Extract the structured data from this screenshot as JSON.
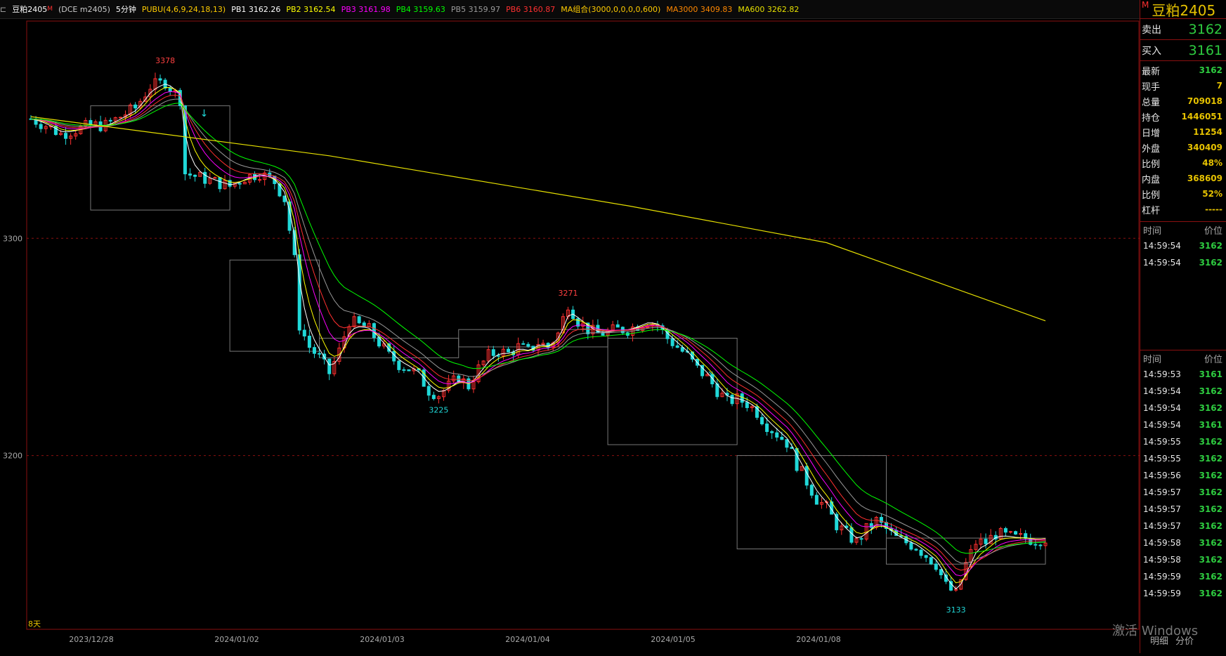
{
  "topbar": {
    "menu_icon": "menu-icon",
    "symbol": "豆粕2405",
    "flag": "M",
    "code": "(DCE m2405)",
    "period": "5分钟",
    "indicator": "PUBU(4,6,9,24,18,13)",
    "pb1": "PB1 3162.26",
    "pb2": "PB2 3162.54",
    "pb3": "PB3 3161.98",
    "pb4": "PB4 3159.63",
    "pb5": "PB5 3159.97",
    "pb6": "PB6 3160.87",
    "ma_combo": "MA组合(3000,0,0,0,0,600)",
    "ma3000": "MA3000 3409.83",
    "ma600": "MA600 3262.82"
  },
  "colors": {
    "pb1": "#ffffff",
    "pb2": "#ffff00",
    "pb3": "#ff00ff",
    "pb4": "#00ff00",
    "pb5": "#9a9a9a",
    "pb6": "#ff3030",
    "ma_combo": "#ffcc00",
    "ma3000": "#ff8800",
    "ma600": "#e6e000",
    "up": "#ff3030",
    "down": "#20d8d8"
  },
  "chart_data": {
    "type": "candlestick",
    "y_labels": [
      "3300",
      "3200"
    ],
    "x_labels": [
      "2023/12/28",
      "2024/01/02",
      "2024/01/03",
      "2024/01/04",
      "2024/01/05",
      "2024/01/08"
    ],
    "range_label": "8天",
    "annotations": {
      "high_label": "3378",
      "low1_label": "3225",
      "high2_label": "3271",
      "low2_label": "3133"
    },
    "ylim": [
      3120,
      3400
    ],
    "price_path": [
      [
        0,
        3355
      ],
      [
        3,
        3352
      ],
      [
        6,
        3348
      ],
      [
        9,
        3350
      ],
      [
        12,
        3352
      ],
      [
        15,
        3352
      ],
      [
        18,
        3356
      ],
      [
        21,
        3360
      ],
      [
        24,
        3370
      ],
      [
        27,
        3372
      ],
      [
        30,
        3364
      ],
      [
        31,
        3330
      ],
      [
        34,
        3328
      ],
      [
        37,
        3326
      ],
      [
        40,
        3324
      ],
      [
        43,
        3328
      ],
      [
        46,
        3330
      ],
      [
        49,
        3326
      ],
      [
        51,
        3318
      ],
      [
        53,
        3290
      ],
      [
        54,
        3260
      ],
      [
        56,
        3250
      ],
      [
        58,
        3245
      ],
      [
        60,
        3238
      ],
      [
        62,
        3248
      ],
      [
        64,
        3262
      ],
      [
        66,
        3260
      ],
      [
        68,
        3258
      ],
      [
        70,
        3252
      ],
      [
        72,
        3246
      ],
      [
        74,
        3242
      ],
      [
        76,
        3240
      ],
      [
        78,
        3237
      ],
      [
        80,
        3230
      ],
      [
        82,
        3228
      ],
      [
        84,
        3232
      ],
      [
        86,
        3236
      ],
      [
        88,
        3232
      ],
      [
        90,
        3240
      ],
      [
        92,
        3246
      ],
      [
        94,
        3248
      ],
      [
        96,
        3247
      ],
      [
        98,
        3250
      ],
      [
        100,
        3248
      ],
      [
        102,
        3252
      ],
      [
        104,
        3250
      ],
      [
        106,
        3256
      ],
      [
        108,
        3270
      ],
      [
        110,
        3262
      ],
      [
        112,
        3258
      ],
      [
        114,
        3256
      ],
      [
        116,
        3257
      ],
      [
        118,
        3258
      ],
      [
        120,
        3258
      ],
      [
        122,
        3260
      ],
      [
        124,
        3262
      ],
      [
        126,
        3260
      ],
      [
        128,
        3254
      ],
      [
        130,
        3250
      ],
      [
        132,
        3246
      ],
      [
        134,
        3240
      ],
      [
        136,
        3236
      ],
      [
        138,
        3230
      ],
      [
        140,
        3225
      ],
      [
        142,
        3226
      ],
      [
        144,
        3224
      ],
      [
        146,
        3220
      ],
      [
        148,
        3214
      ],
      [
        150,
        3210
      ],
      [
        152,
        3206
      ],
      [
        154,
        3196
      ],
      [
        156,
        3188
      ],
      [
        158,
        3180
      ],
      [
        160,
        3176
      ],
      [
        162,
        3168
      ],
      [
        164,
        3164
      ],
      [
        166,
        3160
      ],
      [
        168,
        3166
      ],
      [
        170,
        3170
      ],
      [
        172,
        3166
      ],
      [
        174,
        3162
      ],
      [
        176,
        3160
      ],
      [
        178,
        3158
      ],
      [
        180,
        3154
      ],
      [
        182,
        3150
      ],
      [
        184,
        3140
      ],
      [
        186,
        3136
      ],
      [
        188,
        3150
      ],
      [
        190,
        3160
      ],
      [
        192,
        3160
      ],
      [
        194,
        3164
      ],
      [
        196,
        3163
      ],
      [
        198,
        3162
      ],
      [
        200,
        3162
      ],
      [
        202,
        3161
      ],
      [
        204,
        3162
      ]
    ],
    "ma600_path": [
      [
        0,
        3356
      ],
      [
        60,
        3338
      ],
      [
        120,
        3315
      ],
      [
        160,
        3298
      ],
      [
        204,
        3262
      ]
    ],
    "ma3000_label": "MA3000 3409.83",
    "boxes": [
      [
        12,
        3361,
        40,
        3313
      ],
      [
        40,
        3290,
        58,
        3248
      ],
      [
        58,
        3254,
        86,
        3245
      ],
      [
        86,
        3258,
        116,
        3250
      ],
      [
        116,
        3254,
        142,
        3205
      ],
      [
        142,
        3200,
        172,
        3157
      ],
      [
        172,
        3162,
        204,
        3150
      ]
    ]
  },
  "panel": {
    "flag": "M",
    "title": "豆粕2405",
    "sell_label": "卖出",
    "sell_val": "3162",
    "buy_label": "买入",
    "buy_val": "3161",
    "stats": [
      {
        "label": "最新",
        "value": "3162",
        "color": "#2ecc40"
      },
      {
        "label": "现手",
        "value": "7",
        "color": "#e6c200"
      },
      {
        "label": "总量",
        "value": "709018",
        "color": "#e6c200"
      },
      {
        "label": "持仓",
        "value": "1446051",
        "color": "#e6c200"
      },
      {
        "label": "日增",
        "value": "11254",
        "color": "#e6c200"
      },
      {
        "label": "外盘",
        "value": "340409",
        "color": "#e6c200"
      },
      {
        "label": "比例",
        "value": "48%",
        "color": "#e6c200"
      },
      {
        "label": "内盘",
        "value": "368609",
        "color": "#e6c200"
      },
      {
        "label": "比例",
        "value": "52%",
        "color": "#e6c200"
      },
      {
        "label": "杠杆",
        "value": "-----",
        "color": "#e6c200"
      }
    ],
    "tick_head": {
      "time": "时间",
      "price": "价位"
    },
    "ticks1": [
      {
        "time": "14:59:54",
        "price": "3162"
      },
      {
        "time": "14:59:54",
        "price": "3162"
      }
    ],
    "ticks2": [
      {
        "time": "14:59:53",
        "price": "3161"
      },
      {
        "time": "14:59:54",
        "price": "3162"
      },
      {
        "time": "14:59:54",
        "price": "3162"
      },
      {
        "time": "14:59:54",
        "price": "3161"
      },
      {
        "time": "14:59:55",
        "price": "3162"
      },
      {
        "time": "14:59:55",
        "price": "3162"
      },
      {
        "time": "14:59:56",
        "price": "3162"
      },
      {
        "time": "14:59:57",
        "price": "3162"
      },
      {
        "time": "14:59:57",
        "price": "3162"
      },
      {
        "time": "14:59:57",
        "price": "3162"
      },
      {
        "time": "14:59:58",
        "price": "3162"
      },
      {
        "time": "14:59:58",
        "price": "3162"
      },
      {
        "time": "14:59:59",
        "price": "3162"
      },
      {
        "time": "14:59:59",
        "price": "3162"
      }
    ],
    "tabs": [
      "明细",
      "分价"
    ]
  },
  "watermark": "激活 Windows"
}
